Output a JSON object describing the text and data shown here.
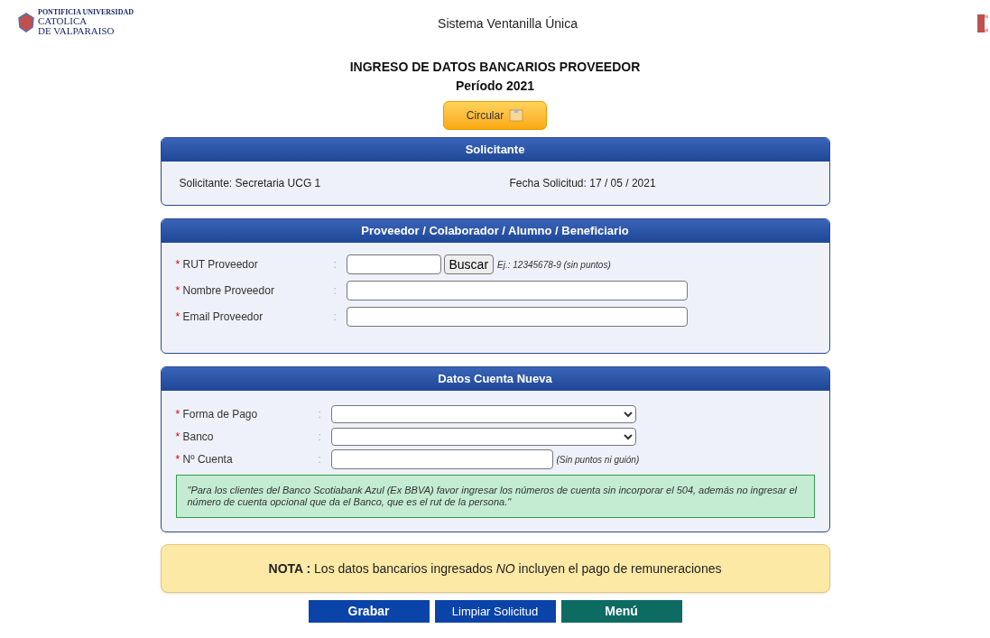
{
  "header": {
    "logo_lines": [
      "PONTIFICIA UNIVERSIDAD",
      "CATOLICA",
      "DE VALPARAISO"
    ],
    "title": "Sistema Ventanilla Única"
  },
  "page_title": "INGRESO DE DATOS BANCARIOS PROVEEDOR",
  "period": "Período 2021",
  "circular_button": "Circular",
  "solicitante": {
    "heading": "Solicitante",
    "left_label": "Solicitante:",
    "left_value": "Secretaria UCG 1",
    "right_label": "Fecha Solicitud:",
    "right_value": "17 / 05 / 2021"
  },
  "proveedor": {
    "heading": "Proveedor / Colaborador / Alumno / Beneficiario",
    "fields": [
      {
        "kind": "search",
        "required": true,
        "required_mark": "*",
        "colon": ":",
        "label": "RUT Proveedor",
        "button": "Buscar",
        "hint": "Ej.: 12345678-9 (sin puntos)"
      },
      {
        "kind": "text",
        "required": true,
        "required_mark": "*",
        "colon": ":",
        "label": "Nombre Proveedor"
      },
      {
        "kind": "text",
        "required": true,
        "required_mark": "*",
        "colon": ":",
        "label": "Email Proveedor"
      }
    ]
  },
  "cuenta": {
    "heading": "Datos Cuenta Nueva",
    "fields": [
      {
        "kind": "select",
        "required": true,
        "required_mark": "*",
        "colon": ":",
        "label": "Forma de Pago"
      },
      {
        "kind": "select",
        "required": true,
        "required_mark": "*",
        "colon": ":",
        "label": "Banco"
      },
      {
        "kind": "short",
        "required": true,
        "required_mark": "*",
        "colon": ":",
        "label": "Nº Cuenta",
        "hint": "(Sin puntos ni guión)"
      }
    ],
    "notice": "\"Para los clientes del Banco Scotiabank Azul (Ex BBVA) favor ingresar los números de cuenta sin incorporar el 504, además no ingresar el número de cuenta opcional que da el Banco, que es el rut de la persona.\""
  },
  "nota": "**NOTA :** Los datos bancarios ingresados *NO* incluyen el pago de remuneraciones",
  "actions": [
    {
      "kind": "primary",
      "label": "Grabar"
    },
    {
      "kind": "secondary",
      "label": "Limpiar Solicitud"
    },
    {
      "kind": "menu",
      "label": "Menú"
    }
  ]
}
